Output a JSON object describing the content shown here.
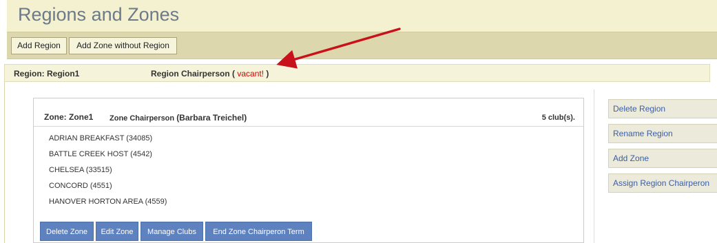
{
  "page": {
    "title": "Regions and Zones"
  },
  "toolbar": {
    "add_region": "Add Region",
    "add_zone_without_region": "Add Zone without Region"
  },
  "region": {
    "label": "Region: Region1",
    "chair_prefix": "Region Chairperson ( ",
    "chair_value": "vacant!",
    "chair_suffix": " )"
  },
  "zone": {
    "label": "Zone: Zone1",
    "chair_label": "Zone Chairperson ",
    "chair_name": "(Barbara Treichel)",
    "club_count": "5 club(s).",
    "clubs": [
      "ADRIAN BREAKFAST (34085)",
      "BATTLE CREEK HOST (4542)",
      "CHELSEA (33515)",
      "CONCORD (4551)",
      "HANOVER HORTON AREA (4559)"
    ],
    "actions": {
      "delete_zone": "Delete Zone",
      "edit_zone": "Edit Zone",
      "manage_clubs": "Manage Clubs",
      "end_chair_term": "End Zone Chairperon Term"
    }
  },
  "sidebar": {
    "delete_region": "Delete Region",
    "rename_region": "Rename Region",
    "add_zone": "Add Zone",
    "assign_chair": "Assign Region Chairperon"
  },
  "colors": {
    "header_bg": "#f3f1cf",
    "toolbar_bg": "#ddd7ad",
    "accent_blue": "#5e81c0",
    "link_blue": "#3a5ea5",
    "vacant_red": "#d40000",
    "arrow_red": "#c8121b"
  }
}
